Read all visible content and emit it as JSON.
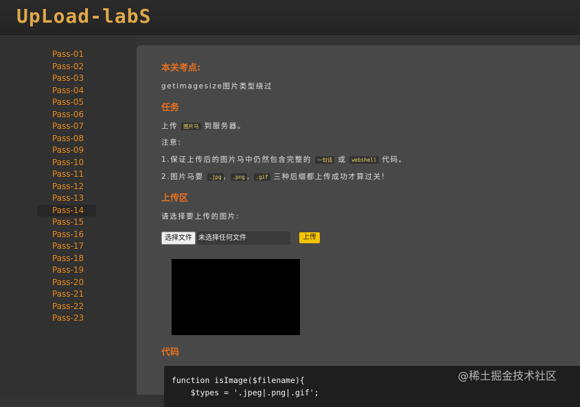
{
  "header": {
    "logo": "UpLoad-labS"
  },
  "sidebar": {
    "items": [
      "Pass-01",
      "Pass-02",
      "Pass-03",
      "Pass-04",
      "Pass-05",
      "Pass-06",
      "Pass-07",
      "Pass-08",
      "Pass-09",
      "Pass-10",
      "Pass-11",
      "Pass-12",
      "Pass-13",
      "Pass-14",
      "Pass-15",
      "Pass-16",
      "Pass-17",
      "Pass-18",
      "Pass-19",
      "Pass-20",
      "Pass-21",
      "Pass-22",
      "Pass-23"
    ],
    "active": "Pass-14"
  },
  "main": {
    "focus_heading": "本关考点:",
    "focus_text": "getimagesize图片类型绕过",
    "task_heading": "任务",
    "task_pre": "上传",
    "task_code": "图片马",
    "task_post": "到服务器。",
    "note_label": "注意:",
    "note1_pre": "1.保证上传后的图片马中仍然包含完整的",
    "note1_code1": "一句话",
    "note1_mid": "或",
    "note1_code2": "webshell",
    "note1_post": "代码。",
    "note2_pre": "2.图片马要",
    "note2_code1": ".jpg",
    "note2_sep1": ",",
    "note2_code2": ".png",
    "note2_sep2": ",",
    "note2_code3": ".gif",
    "note2_post": "三种后缀都上传成功才算过关!",
    "upload_heading": "上传区",
    "upload_prompt": "请选择要上传的图片:",
    "choose_file_label": "选择文件",
    "no_file_text": "未选择任何文件",
    "upload_button": "上传",
    "code_heading": "代码",
    "code_line1": "function isImage($filename){",
    "code_line2": "    $types = '.jpeg|.png|.gif';"
  },
  "watermark": "@稀土掘金技术社区"
}
